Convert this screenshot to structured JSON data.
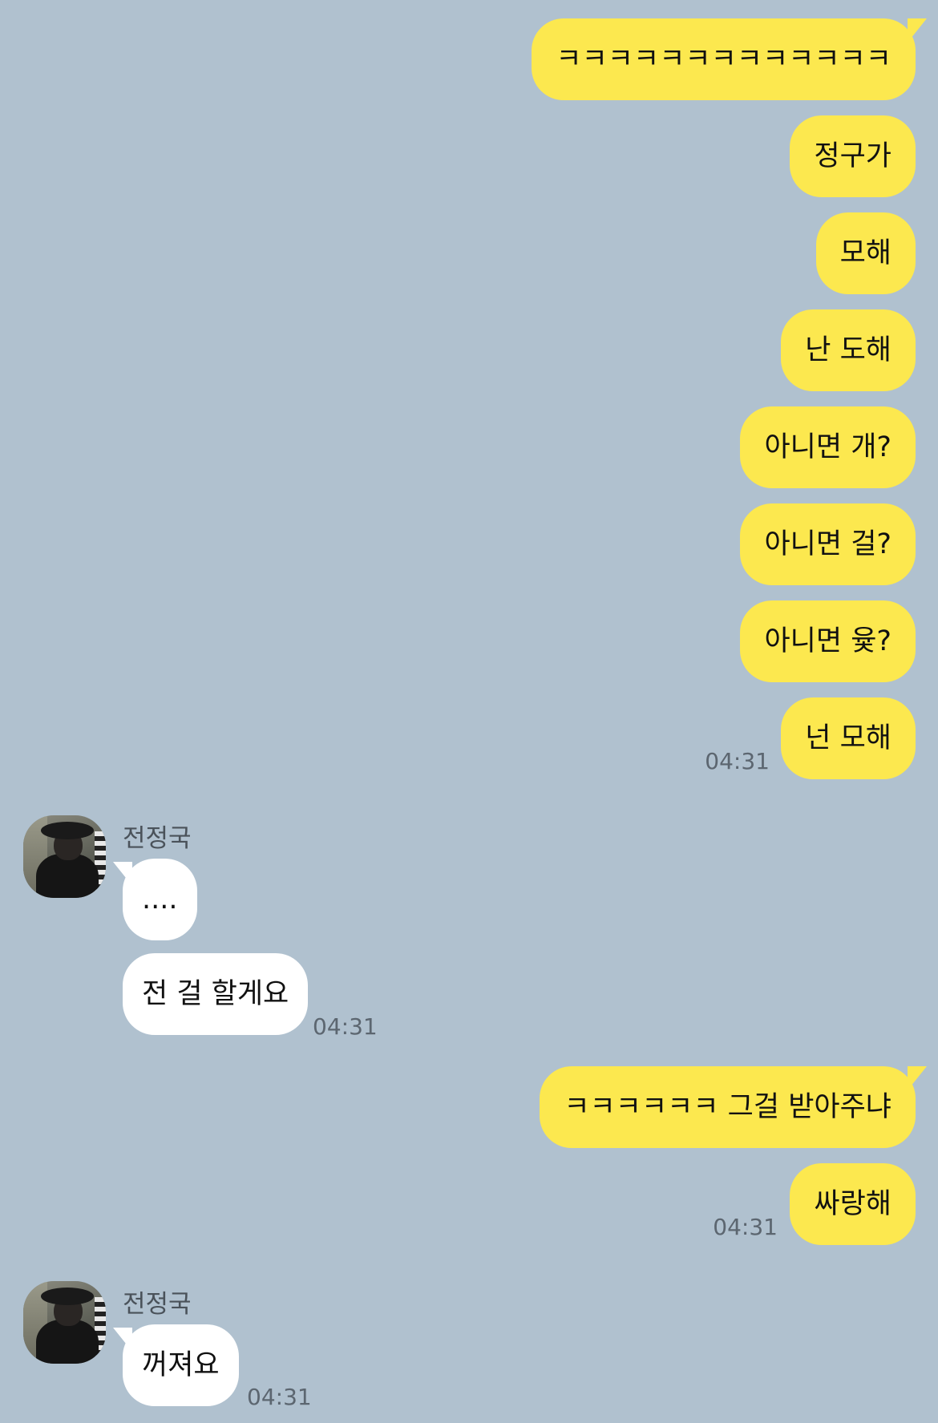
{
  "colors": {
    "background": "#b0c1cf",
    "my_bubble": "#fce84f",
    "their_bubble": "#ffffff"
  },
  "messages_block_1": [
    "ㅋㅋㅋㅋㅋㅋㅋㅋㅋㅋㅋㅋㅋ",
    "정구가",
    "모해",
    "난 도해",
    "아니면 개?",
    "아니면 걸?",
    "아니면 윷?",
    "넌 모해"
  ],
  "time_block_1": "04:31",
  "contact": {
    "name": "전정국",
    "avatar_icon": "profile-photo"
  },
  "reply_block_1": [
    "....",
    "전 걸 할게요"
  ],
  "time_reply_1": "04:31",
  "messages_block_2": [
    "ㅋㅋㅋㅋㅋㅋ 그걸 받아주냐",
    "싸랑해"
  ],
  "time_block_2": "04:31",
  "reply_block_2": [
    "꺼져요"
  ],
  "time_reply_2": "04:31"
}
